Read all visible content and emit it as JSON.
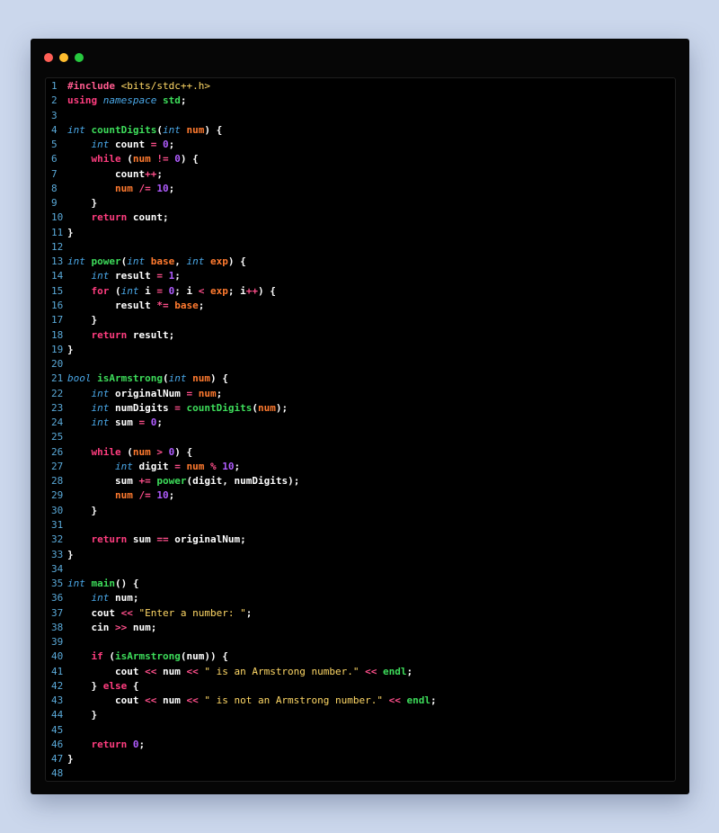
{
  "window": {
    "dots": [
      "close",
      "minimize",
      "maximize"
    ],
    "colors": {
      "close": "#ff5f56",
      "minimize": "#ffbd2e",
      "maximize": "#27c93f",
      "background": "#060606"
    }
  },
  "editor": {
    "language": "cpp",
    "line_numbers": [
      "1",
      "2",
      "3",
      "4",
      "5",
      "6",
      "7",
      "8",
      "9",
      "10",
      "11",
      "12",
      "13",
      "14",
      "15",
      "16",
      "17",
      "18",
      "19",
      "20",
      "21",
      "22",
      "23",
      "24",
      "25",
      "26",
      "27",
      "28",
      "29",
      "30",
      "31",
      "32",
      "33",
      "34",
      "35",
      "36",
      "37",
      "38",
      "39",
      "40",
      "41",
      "42",
      "43",
      "44",
      "45",
      "46",
      "47",
      "48"
    ],
    "lines": [
      "#include <bits/stdc++.h>",
      "using namespace std;",
      "",
      "int countDigits(int num) {",
      "    int count = 0;",
      "    while (num != 0) {",
      "        count++;",
      "        num /= 10;",
      "    }",
      "    return count;",
      "}",
      "",
      "int power(int base, int exp) {",
      "    int result = 1;",
      "    for (int i = 0; i < exp; i++) {",
      "        result *= base;",
      "    }",
      "    return result;",
      "}",
      "",
      "bool isArmstrong(int num) {",
      "    int originalNum = num;",
      "    int numDigits = countDigits(num);",
      "    int sum = 0;",
      "",
      "    while (num > 0) {",
      "        int digit = num % 10;",
      "        sum += power(digit, numDigits);",
      "        num /= 10;",
      "    }",
      "",
      "    return sum == originalNum;",
      "}",
      "",
      "int main() {",
      "    int num;",
      "    cout << \"Enter a number: \";",
      "    cin >> num;",
      "",
      "    if (isArmstrong(num)) {",
      "        cout << num << \" is an Armstrong number.\" << endl;",
      "    } else {",
      "        cout << num << \" is not an Armstrong number.\" << endl;",
      "    }",
      "",
      "    return 0;",
      "}",
      ""
    ]
  }
}
